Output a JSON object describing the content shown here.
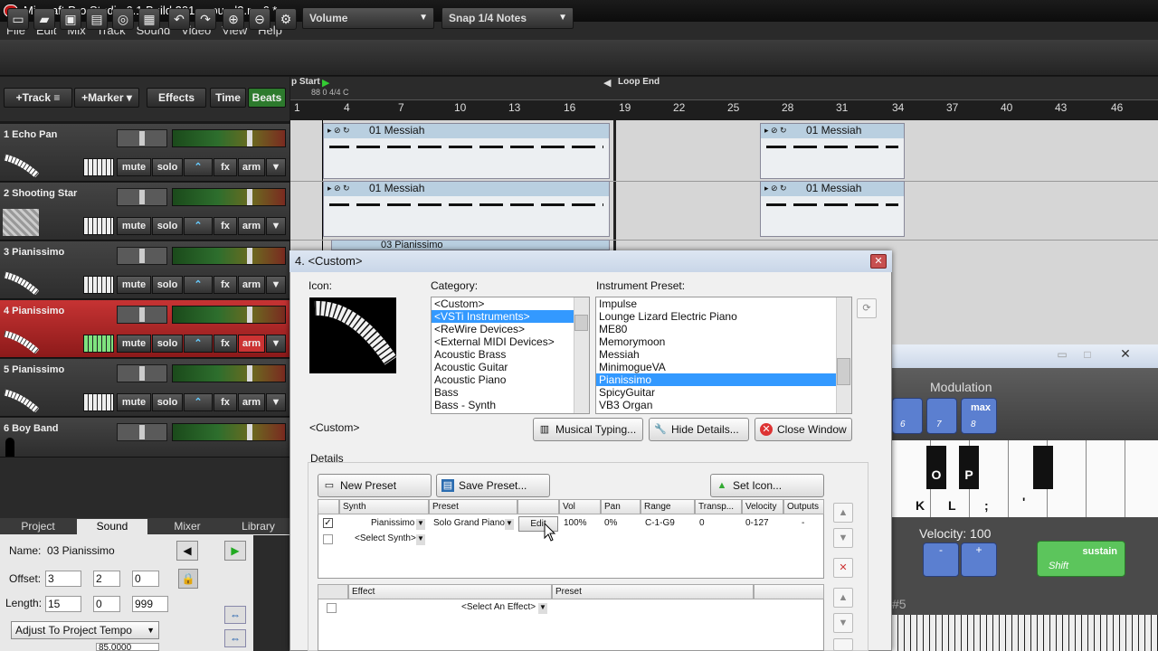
{
  "window": {
    "title": "Mixcraft Pro Studio 6.1 Build 201 - sound3.mx6 *"
  },
  "menu": [
    "File",
    "Edit",
    "Mix",
    "Track",
    "Sound",
    "Video",
    "View",
    "Help"
  ],
  "toolbar": {
    "volume_dropdown": "Volume",
    "snap_dropdown": "Snap 1/4 Notes"
  },
  "track_header": {
    "add_track": "+Track",
    "add_marker": "+Marker",
    "effects": "Effects",
    "time": "Time",
    "beats": "Beats"
  },
  "tracks": [
    {
      "name": "1 Echo Pan",
      "mute": "mute",
      "solo": "solo",
      "fx": "fx",
      "arm": "arm"
    },
    {
      "name": "2 Shooting Star",
      "mute": "mute",
      "solo": "solo",
      "fx": "fx",
      "arm": "arm"
    },
    {
      "name": "3 Pianissimo",
      "mute": "mute",
      "solo": "solo",
      "fx": "fx",
      "arm": "arm"
    },
    {
      "name": "4 Pianissimo",
      "mute": "mute",
      "solo": "solo",
      "fx": "fx",
      "arm": "arm"
    },
    {
      "name": "5 Pianissimo",
      "mute": "mute",
      "solo": "solo",
      "fx": "fx",
      "arm": "arm"
    },
    {
      "name": "6 Boy Band",
      "mute": "mute",
      "solo": "solo",
      "fx": "fx",
      "arm": "arm"
    }
  ],
  "timeline": {
    "loop_start": "p Start",
    "loop_end": "Loop End",
    "tempo_sig": "88 0 4/4 C",
    "ruler": [
      "1",
      "4",
      "7",
      "10",
      "13",
      "16",
      "19",
      "22",
      "25",
      "28",
      "31",
      "34",
      "37",
      "40",
      "43",
      "46"
    ],
    "clips": {
      "messiah_1": "01 Messiah",
      "messiah_2": "01 Messiah",
      "messiah_3": "01 Messiah",
      "messiah_4": "01 Messiah",
      "pianissimo": "03 Pianissimo"
    }
  },
  "bottom_panel": {
    "tabs": [
      "Project",
      "Sound",
      "Mixer",
      "Library"
    ],
    "name_label": "Name:",
    "name_value": "03 Pianissimo",
    "offset_label": "Offset:",
    "offset_values": [
      "3",
      "2",
      "0"
    ],
    "length_label": "Length:",
    "length_values": [
      "15",
      "0",
      "999"
    ],
    "tempo_mode": "Adjust To Project Tempo",
    "tempo_value": "85.0000"
  },
  "dialog": {
    "title": "4. <Custom>",
    "icon_label": "Icon:",
    "category_label": "Category:",
    "preset_label": "Instrument Preset:",
    "categories": [
      "<Custom>",
      "<VSTi Instruments>",
      "<ReWire Devices>",
      "<External MIDI Devices>",
      "Acoustic Brass",
      "Acoustic Guitar",
      "Acoustic Piano",
      "Bass",
      "Bass - Synth"
    ],
    "selected_category": 1,
    "presets": [
      "Impulse",
      "Lounge Lizard Electric Piano",
      "ME80",
      "Memorymoon",
      "Messiah",
      "MinimogueVA",
      "Pianissimo",
      "SpicyGuitar",
      "VB3 Organ"
    ],
    "selected_preset": 6,
    "current_name": "<Custom>",
    "musical_typing_btn": "Musical Typing...",
    "hide_details_btn": "Hide Details...",
    "close_window_btn": "Close Window",
    "details_label": "Details",
    "new_preset_btn": "New Preset",
    "save_preset_btn": "Save Preset...",
    "set_icon_btn": "Set Icon...",
    "synth_headers": [
      "Synth",
      "Preset",
      "",
      "Vol",
      "Pan",
      "Range",
      "Transp...",
      "Velocity",
      "Outputs"
    ],
    "synth_row": {
      "synth": "Pianissimo",
      "preset": "Solo Grand Piano",
      "edit": "Edit",
      "vol": "100%",
      "pan": "0%",
      "range": "C-1-G9",
      "transpose": "0",
      "velocity": "0-127",
      "outputs": "-"
    },
    "select_synth": "<Select Synth>",
    "effect_headers": [
      "Effect",
      "Preset"
    ],
    "select_effect": "<Select An Effect>"
  },
  "musical_typing": {
    "modulation_label": "Modulation",
    "mod_keys": [
      "6",
      "7",
      "8"
    ],
    "max_label": "max",
    "key_labels": [
      "O",
      "P"
    ],
    "lower_keys": [
      "K",
      "L",
      ";",
      "'"
    ],
    "velocity_label": "Velocity: 100",
    "sustain_label": "sustain",
    "shift_label": "Shift",
    "octave_label": "#5"
  },
  "colors": {
    "accent_red": "#c63333",
    "selection_blue": "#3399ff",
    "clip_header": "#b9cfe0"
  }
}
